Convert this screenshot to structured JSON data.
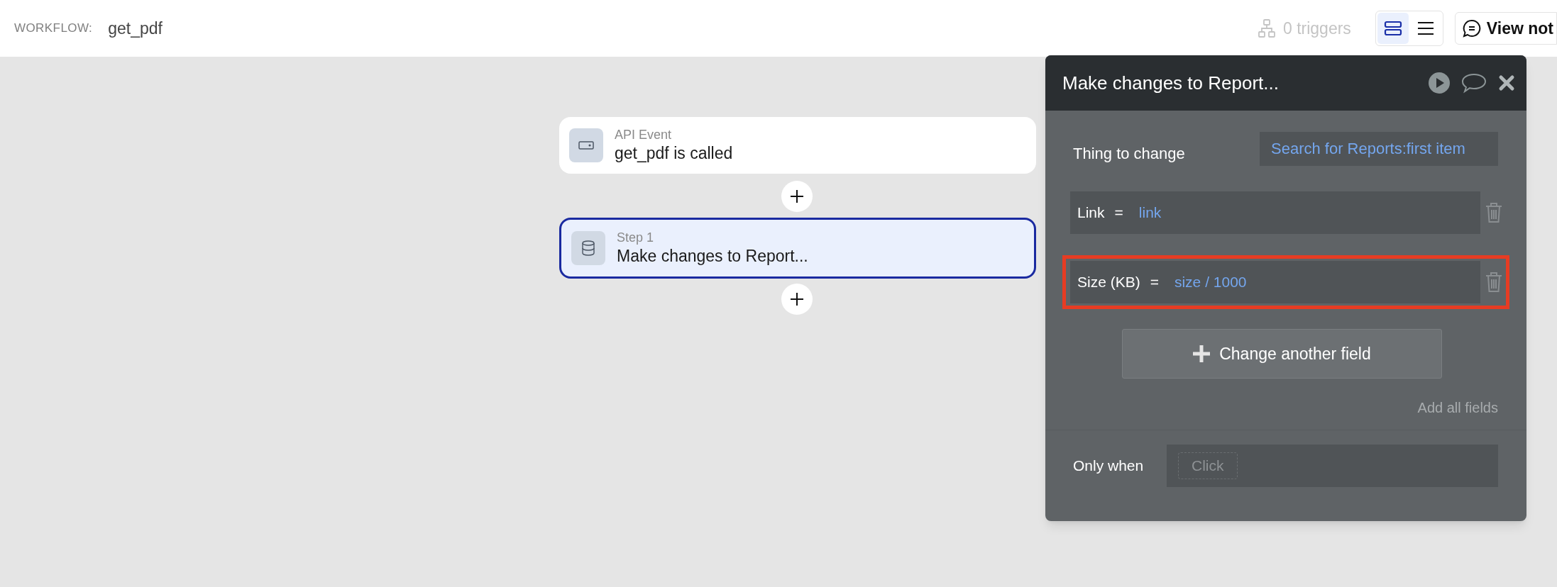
{
  "topbar": {
    "label": "WORKFLOW:",
    "name": "get_pdf",
    "triggers": "0 triggers",
    "view_toggle": [
      {
        "kind": "cards",
        "selected": true
      },
      {
        "kind": "list",
        "selected": false
      }
    ],
    "notes_button": "View not"
  },
  "canvas": {
    "steps": [
      {
        "kind": "event",
        "caption": "API Event",
        "title": "get_pdf is called",
        "selected": false
      },
      {
        "kind": "action",
        "caption": "Step 1",
        "title": "Make changes to Report...",
        "selected": true
      }
    ]
  },
  "panel": {
    "title": "Make changes to Report...",
    "thing_label": "Thing to change",
    "thing_value": "Search for Reports:first item",
    "fields": [
      {
        "name": "Link",
        "op": "=",
        "value": "link",
        "highlighted": false
      },
      {
        "name": "Size (KB)",
        "op": "=",
        "value": "size / 1000",
        "highlighted": true
      }
    ],
    "add_button": "Change another field",
    "add_all": "Add all fields",
    "condition_label": "Only when",
    "condition_placeholder": "Click"
  }
}
